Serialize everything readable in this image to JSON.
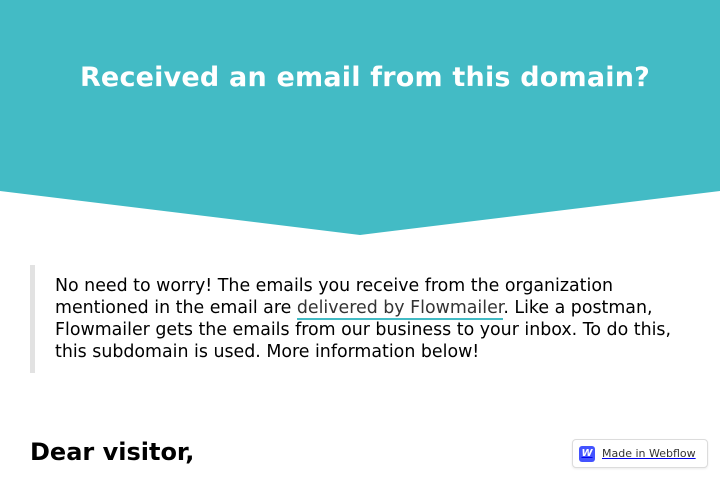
{
  "colors": {
    "hero_background": "#43bbc5",
    "link_underline": "#43bbc5",
    "quote_border": "#e2e2e2",
    "webflow_blue": "#4353ff"
  },
  "hero": {
    "title": "Received an email from this domain?"
  },
  "notice": {
    "text_before_link": "No need to worry! The emails you receive from the organization mentioned in the email are ",
    "link_text": "delivered by Flowmailer",
    "text_after_link": ". Like a postman, Flowmailer gets the emails from our business to your inbox. To do this, this subdomain is used. More information below!"
  },
  "greeting": "Dear visitor,",
  "badge": {
    "icon": "webflow-logo-icon",
    "logo_letter": "W",
    "label": "Made in Webflow"
  }
}
